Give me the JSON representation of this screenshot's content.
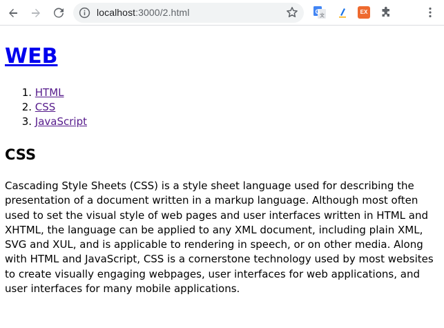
{
  "browser": {
    "url_host": "localhost",
    "url_rest": ":3000/2.html",
    "icons": {
      "back": "arrow-left-icon",
      "forward": "arrow-right-icon",
      "reload": "reload-icon",
      "info": "info-icon",
      "bookmark": "star-icon",
      "translate_ext": "google-translate-icon",
      "ext2": "pen-extension-icon",
      "ext3_label": "EX",
      "extensions": "puzzle-icon",
      "menu": "kebab-menu-icon"
    }
  },
  "page": {
    "site_title": "WEB",
    "nav": [
      {
        "number": "1.",
        "label": "HTML"
      },
      {
        "number": "2.",
        "label": "CSS"
      },
      {
        "number": "3.",
        "label": "JavaScript"
      }
    ],
    "section_title": "CSS",
    "paragraph": "Cascading Style Sheets (CSS) is a style sheet language used for describing the presentation of a document written in a markup language. Although most often used to set the visual style of web pages and user interfaces written in HTML and XHTML, the language can be applied to any XML document, including plain XML, SVG and XUL, and is applicable to rendering in speech, or on other media. Along with HTML and JavaScript, CSS is a cornerstone technology used by most websites to create visually engaging webpages, user interfaces for web applications, and user interfaces for many mobile applications."
  },
  "colors": {
    "link": "#0000ee",
    "visited_link": "#551a8b",
    "toolbar_icon": "#5f6368",
    "omnibox_bg": "#f1f3f4"
  }
}
